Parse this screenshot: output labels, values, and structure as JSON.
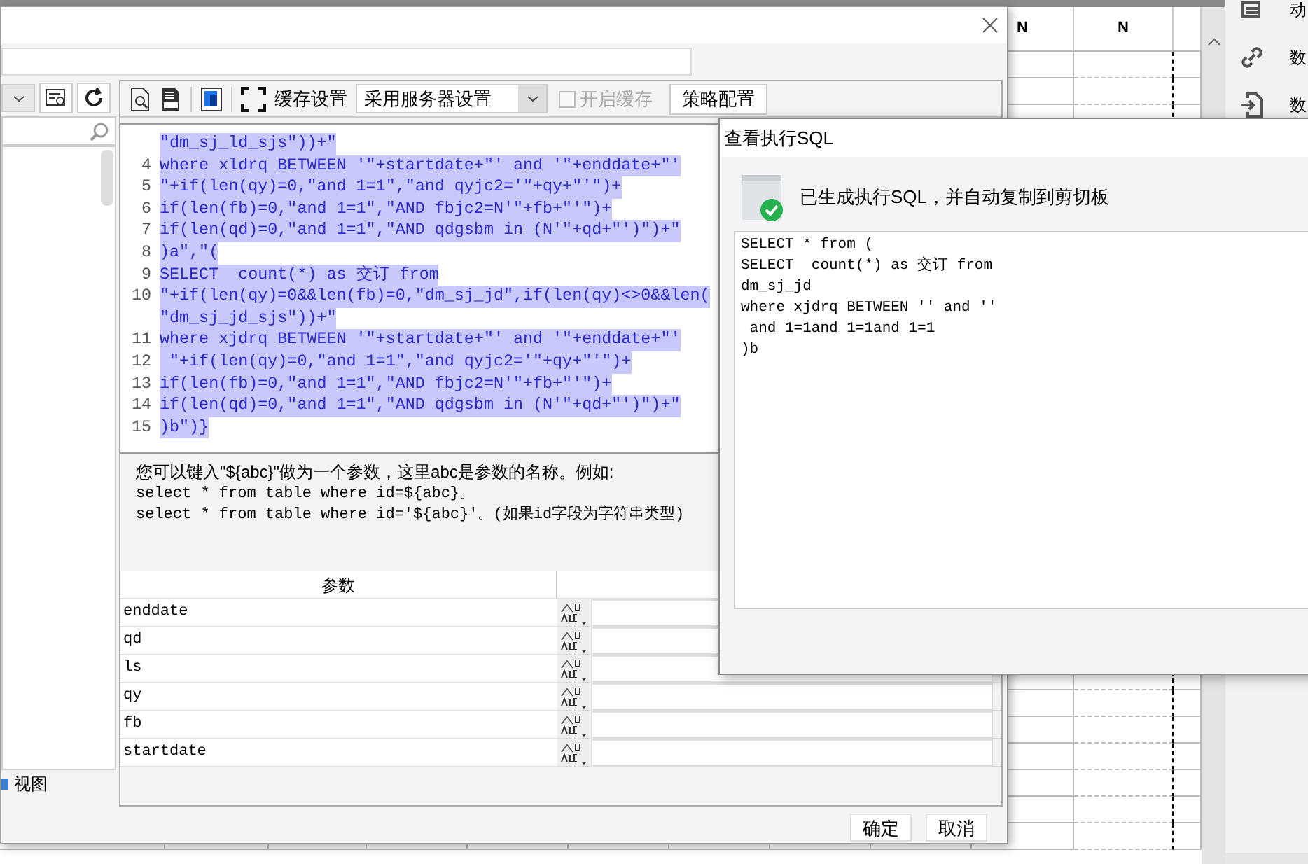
{
  "sheet": {
    "column_headers": [
      "N",
      "N"
    ]
  },
  "side_panel": {
    "items": [
      "动",
      "数",
      "数"
    ]
  },
  "main_dialog": {
    "toolbar": {
      "cache_label": "缓存设置",
      "cache_select": "采用服务器设置",
      "enable_cache": {
        "label": "开启缓存",
        "checked": false,
        "disabled": true
      },
      "policy_button": "策略配置"
    },
    "left_panel": {
      "view_label": "视图"
    },
    "editor": {
      "lines": [
        {
          "text": "\"dm_sj_ld_sjs\"))+\"",
          "selected": true
        },
        {
          "number": "4",
          "text": "where xldrq BETWEEN '\"+startdate+\"' and '\"+enddate+\"'",
          "selected": true
        },
        {
          "number": "5",
          "text": "\"+if(len(qy)=0,\"and 1=1\",\"and qyjc2='\"+qy+\"'\")+",
          "selected": true
        },
        {
          "number": "6",
          "text": "if(len(fb)=0,\"and 1=1\",\"AND fbjc2=N'\"+fb+\"'\")+",
          "selected": true
        },
        {
          "number": "7",
          "text": "if(len(qd)=0,\"and 1=1\",\"AND qdgsbm in (N'\"+qd+\"')\")+\"",
          "selected": true
        },
        {
          "number": "8",
          "text": ")a\",\"(",
          "selected": true
        },
        {
          "number": "9",
          "text": "SELECT  count(*) as 交订 from",
          "selected": true
        },
        {
          "number": "10",
          "text": "\"+if(len(qy)=0&&len(fb)=0,\"dm_sj_jd\",if(len(qy)<>0&&len(",
          "selected": true
        },
        {
          "text": "\"dm_sj_jd_sjs\"))+\"",
          "selected": true
        },
        {
          "number": "11",
          "text": "where xjdrq BETWEEN '\"+startdate+\"' and '\"+enddate+\"'",
          "selected": true
        },
        {
          "number": "12",
          "text": " \"+if(len(qy)=0,\"and 1=1\",\"and qyjc2='\"+qy+\"'\")+",
          "selected": true
        },
        {
          "number": "13",
          "text": "if(len(fb)=0,\"and 1=1\",\"AND fbjc2=N'\"+fb+\"'\")+",
          "selected": true
        },
        {
          "number": "14",
          "text": "if(len(qd)=0,\"and 1=1\",\"AND qdgsbm in (N'\"+qd+\"')\")+\"",
          "selected": true
        },
        {
          "number": "15",
          "text": ")b\")}",
          "selected": true
        }
      ]
    },
    "help": [
      "您可以键入\"${abc}\"做为一个参数，这里abc是参数的名称。例如:",
      "select * from table where id=${abc}。",
      "select * from table where id='${abc}'。(如果id字段为字符串类型)"
    ],
    "params": {
      "columns": [
        "参数"
      ],
      "rows": [
        {
          "name": "enddate"
        },
        {
          "name": "qd"
        },
        {
          "name": "ls"
        },
        {
          "name": "qy"
        },
        {
          "name": "fb"
        },
        {
          "name": "startdate"
        }
      ]
    },
    "buttons": [
      "确定",
      "取消"
    ]
  },
  "sql_dialog": {
    "title": "查看执行SQL",
    "message": "已生成执行SQL，并自动复制到剪切板",
    "sql": "SELECT * from (\nSELECT  count(*) as 交订 from\ndm_sj_jd\nwhere xjdrq BETWEEN '' and ''\n and 1=1and 1=1and 1=1\n)b"
  }
}
